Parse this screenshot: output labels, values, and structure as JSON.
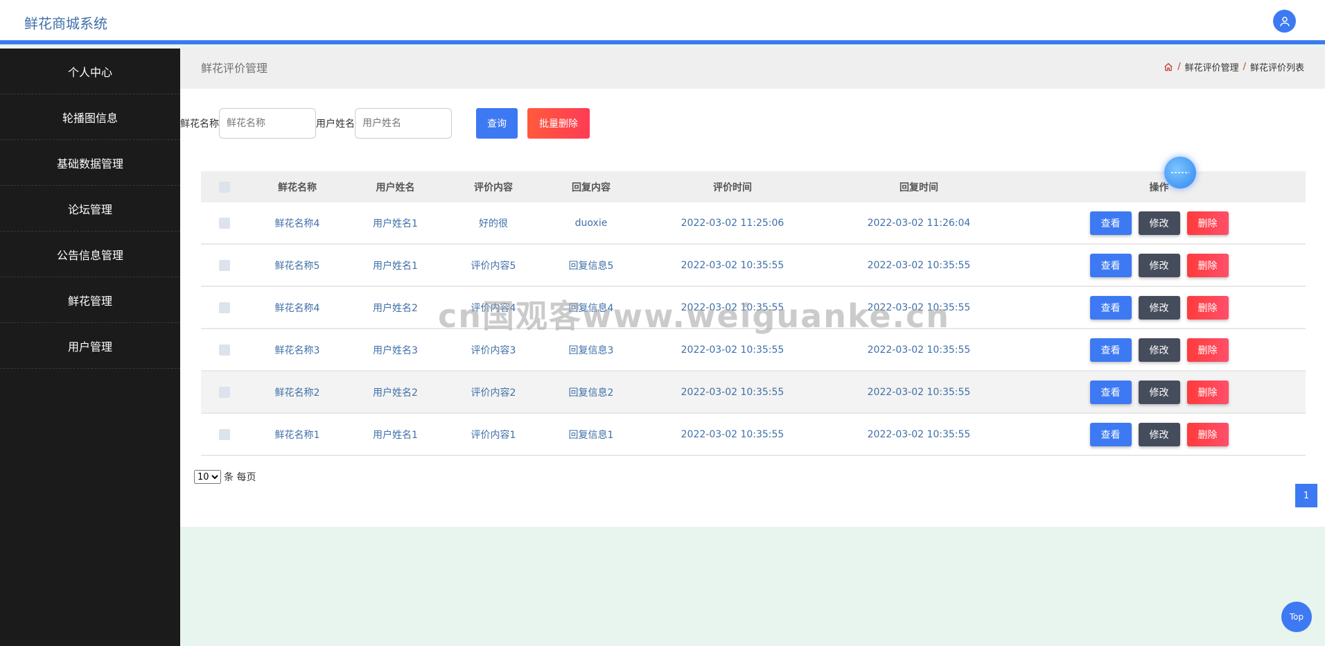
{
  "header": {
    "title": "鲜花商城系统",
    "avatar_icon": "user-icon"
  },
  "sidebar": {
    "items": [
      {
        "label": "个人中心"
      },
      {
        "label": "轮播图信息"
      },
      {
        "label": "基础数据管理"
      },
      {
        "label": "论坛管理"
      },
      {
        "label": "公告信息管理"
      },
      {
        "label": "鲜花管理"
      },
      {
        "label": "用户管理"
      }
    ]
  },
  "page": {
    "title": "鲜花评价管理",
    "breadcrumb": [
      "鲜花评价管理",
      "鲜花评价列表"
    ],
    "breadcrumb_sep": "/",
    "home_icon": "home-icon"
  },
  "search": {
    "flower_label": "鲜花名称",
    "flower_placeholder": "鲜花名称",
    "user_label": "用户姓名",
    "user_placeholder": "用户姓名",
    "query_label": "查询",
    "batch_delete_label": "批量删除"
  },
  "table": {
    "headers": [
      "鲜花名称",
      "用户姓名",
      "评价内容",
      "回复内容",
      "评价时间",
      "回复时间",
      "操作"
    ],
    "rows": [
      {
        "flower": "鲜花名称4",
        "user": "用户姓名1",
        "content": "好的很",
        "reply": "duoxie",
        "eval_time": "2022-03-02 11:25:06",
        "reply_time": "2022-03-02 11:26:04"
      },
      {
        "flower": "鲜花名称5",
        "user": "用户姓名1",
        "content": "评价内容5",
        "reply": "回复信息5",
        "eval_time": "2022-03-02 10:35:55",
        "reply_time": "2022-03-02 10:35:55"
      },
      {
        "flower": "鲜花名称4",
        "user": "用户姓名2",
        "content": "评价内容4",
        "reply": "回复信息4",
        "eval_time": "2022-03-02 10:35:55",
        "reply_time": "2022-03-02 10:35:55"
      },
      {
        "flower": "鲜花名称3",
        "user": "用户姓名3",
        "content": "评价内容3",
        "reply": "回复信息3",
        "eval_time": "2022-03-02 10:35:55",
        "reply_time": "2022-03-02 10:35:55"
      },
      {
        "flower": "鲜花名称2",
        "user": "用户姓名2",
        "content": "评价内容2",
        "reply": "回复信息2",
        "eval_time": "2022-03-02 10:35:55",
        "reply_time": "2022-03-02 10:35:55"
      },
      {
        "flower": "鲜花名称1",
        "user": "用户姓名1",
        "content": "评价内容1",
        "reply": "回复信息1",
        "eval_time": "2022-03-02 10:35:55",
        "reply_time": "2022-03-02 10:35:55"
      }
    ],
    "actions": {
      "view": "查看",
      "edit": "修改",
      "delete": "删除"
    }
  },
  "pagination": {
    "per_page_value": "10",
    "per_page_suffix": "条 每页",
    "current_page": "1"
  },
  "floating": {
    "top_label": "Top"
  },
  "watermark": "cn国观客www.weiguanke.cn",
  "colors": {
    "accent": "#3d79f2",
    "sidebar_bg": "#1b1b1b",
    "danger": "#ff3b3b",
    "dark_button": "#454c5c"
  }
}
